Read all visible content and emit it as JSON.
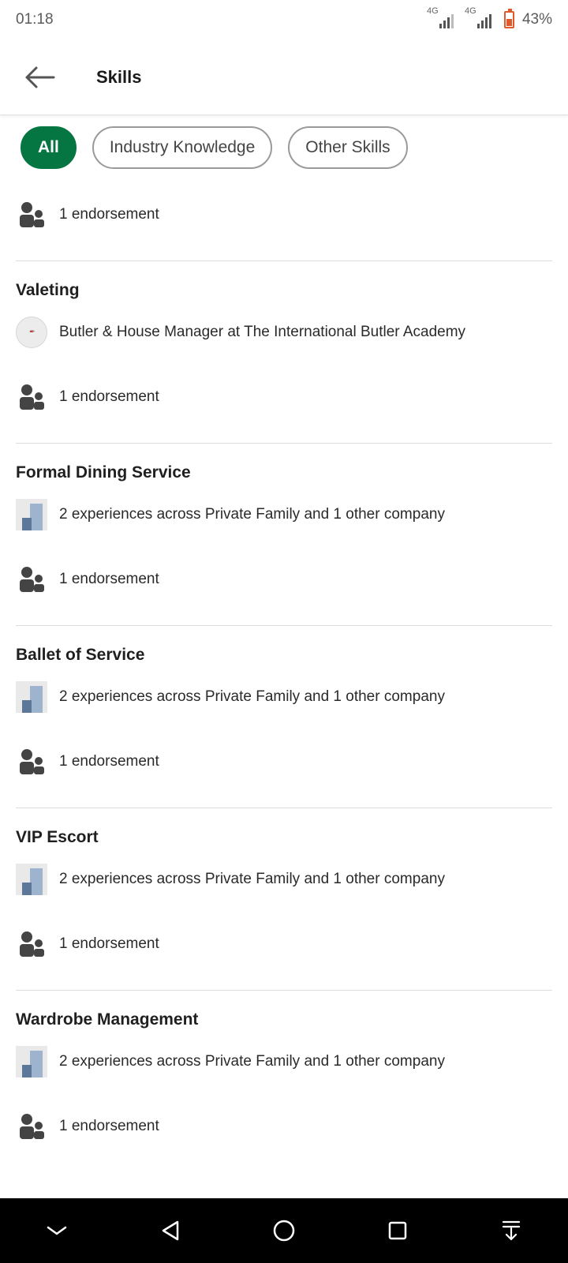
{
  "status_bar": {
    "time": "01:18",
    "network_1": "4G",
    "network_2": "4G",
    "battery_percent": "43%",
    "battery_color": "#e05a2b"
  },
  "header": {
    "back_icon": "arrow-left-icon",
    "title": "Skills"
  },
  "filters": [
    {
      "label": "All",
      "active": true
    },
    {
      "label": "Industry Knowledge",
      "active": false
    },
    {
      "label": "Other Skills",
      "active": false
    }
  ],
  "accent_color": "#057642",
  "first_block": {
    "endorsement": "1 endorsement"
  },
  "skills": [
    {
      "title": "Valeting",
      "detail": "Butler & House Manager at The International Butler Academy",
      "endorsement": "1 endorsement"
    },
    {
      "title": "Formal Dining Service",
      "detail": "2 experiences across Private Family and 1 other company",
      "endorsement": "1 endorsement"
    },
    {
      "title": "Ballet of Service",
      "detail": "2 experiences across Private Family and 1 other company",
      "endorsement": "1 endorsement"
    },
    {
      "title": "VIP Escort",
      "detail": "2 experiences across Private Family and 1 other company",
      "endorsement": "1 endorsement"
    },
    {
      "title": "Wardrobe Management",
      "detail": "2 experiences across Private Family and 1 other company",
      "endorsement": "1 endorsement"
    }
  ],
  "nav_bar": {
    "icons": [
      "chevron-down-icon",
      "back-triangle-icon",
      "home-circle-icon",
      "recents-square-icon",
      "notification-pull-icon"
    ]
  }
}
